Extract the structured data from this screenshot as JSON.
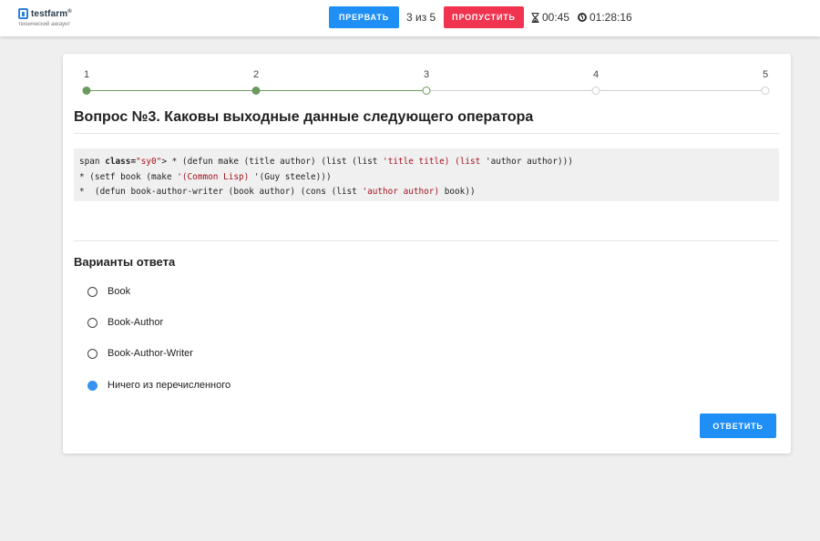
{
  "header": {
    "logo_name": "testfarm",
    "logo_reg": "®",
    "logo_sub": "технический аккаунт",
    "abort_label": "прервать",
    "counter": "3 из 5",
    "skip_label": "пропустить",
    "question_timer": "00:45",
    "total_timer": "01:28:16"
  },
  "stepper": {
    "steps": [
      "1",
      "2",
      "3",
      "4",
      "5"
    ],
    "current": 3,
    "completed": 2,
    "colors": {
      "done": "#6b9a5c",
      "todo": "#cfcfcf"
    }
  },
  "question": {
    "title": "Вопрос №3. Каковы выходные данные следующего оператора",
    "code": {
      "l1_a": "span ",
      "l1_kw": "class=",
      "l1_str1": "\"sy0\"",
      "l1_b": "> * (defun make (title author) (list (list ",
      "l1_str2": "'title title)",
      "l1_c": " ",
      "l1_str3": "(list",
      "l1_d": " 'author author)))",
      "l2_a": "* (setf book (make ",
      "l2_str": "'(Common Lisp)",
      "l2_b": " '(Guy steele)))",
      "l3_a": "*  (defun book-author-writer (book author) (cons (list ",
      "l3_str": "'author author)",
      "l3_b": " book))"
    }
  },
  "answers": {
    "title": "Варианты ответа",
    "options": [
      {
        "label": "Book",
        "selected": false
      },
      {
        "label": "Book-Author",
        "selected": false
      },
      {
        "label": "Book-Author-Writer",
        "selected": false
      },
      {
        "label": "Ничего из перечисленного",
        "selected": true
      }
    ],
    "submit_label": "ответить"
  },
  "colors": {
    "primary": "#1f8ff5",
    "danger": "#f0334f",
    "radio_selected": "#3592f0"
  }
}
